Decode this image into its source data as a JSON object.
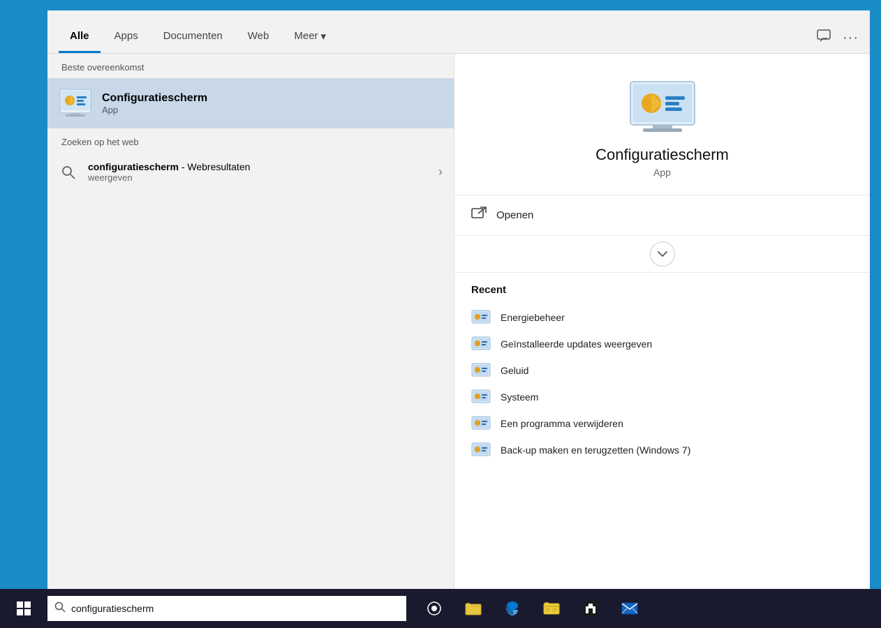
{
  "tabs": {
    "items": [
      {
        "label": "Alle",
        "active": true
      },
      {
        "label": "Apps",
        "active": false
      },
      {
        "label": "Documenten",
        "active": false
      },
      {
        "label": "Web",
        "active": false
      },
      {
        "label": "Meer",
        "active": false
      }
    ]
  },
  "tabs_right": {
    "feedback_icon": "💬",
    "more_icon": "···"
  },
  "left_panel": {
    "best_match_header": "Beste overeenkomst",
    "best_match": {
      "title": "Configuratiescherm",
      "subtitle": "App"
    },
    "web_search_header": "Zoeken op het web",
    "web_search": {
      "main_bold": "configuratiescherm",
      "main_suffix": " - Webresultaten",
      "sub": "weergeven"
    }
  },
  "right_panel": {
    "app_name": "Configuratiescherm",
    "app_type": "App",
    "open_label": "Openen",
    "recent_header": "Recent",
    "recent_items": [
      {
        "label": "Energiebeheer"
      },
      {
        "label": "Geïnstalleerde updates weergeven"
      },
      {
        "label": "Geluid"
      },
      {
        "label": "Systeem"
      },
      {
        "label": "Een programma verwijderen"
      },
      {
        "label": "Back-up maken en terugzetten (Windows 7)"
      }
    ]
  },
  "taskbar": {
    "search_text": "configuratiescherm"
  }
}
